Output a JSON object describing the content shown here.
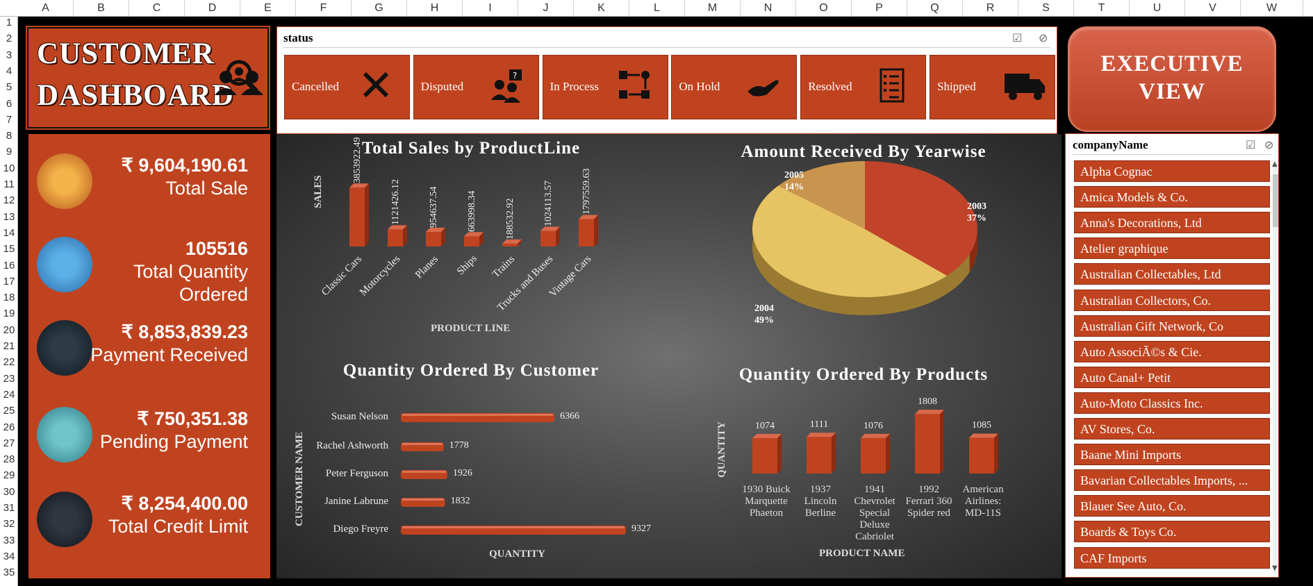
{
  "columns": [
    "A",
    "B",
    "C",
    "D",
    "E",
    "F",
    "G",
    "H",
    "I",
    "J",
    "K",
    "L",
    "M",
    "N",
    "O",
    "P",
    "Q",
    "R",
    "S",
    "T",
    "U",
    "V",
    "W"
  ],
  "rows": [
    "1",
    "2",
    "3",
    "4",
    "5",
    "6",
    "7",
    "8",
    "9",
    "10",
    "11",
    "12",
    "13",
    "14",
    "15",
    "16",
    "17",
    "18",
    "19",
    "20",
    "21",
    "22",
    "23",
    "24",
    "25",
    "26",
    "27",
    "28",
    "29",
    "30",
    "31",
    "32",
    "33",
    "34",
    "35"
  ],
  "title": {
    "line1": "CUSTOMER",
    "line2": "DASHBOARD"
  },
  "kpis": [
    {
      "value": "₹ 9,604,190.61",
      "label": "Total Sale",
      "icon": "money-bag-icon"
    },
    {
      "value": "105516",
      "label": "Total Quantity Ordered",
      "icon": "shopping-cart-icon"
    },
    {
      "value": "₹ 8,853,839.23",
      "label": "Payment Received",
      "icon": "check-badge-icon"
    },
    {
      "value": "₹ 750,351.38",
      "label": "Pending Payment",
      "icon": "alarm-clock-icon"
    },
    {
      "value": "₹ 8,254,400.00",
      "label": "Total Credit Limit",
      "icon": "credit-card-icon"
    }
  ],
  "status_slicer": {
    "header": "status",
    "items": [
      "Cancelled",
      "Disputed",
      "In Process",
      "On Hold",
      "Resolved",
      "Shipped"
    ]
  },
  "executive": {
    "line1": "EXECUTIVE",
    "line2": "VIEW"
  },
  "company_slicer": {
    "header": "companyName",
    "items": [
      "Alpha Cognac",
      "Amica Models & Co.",
      "Anna's Decorations, Ltd",
      "Atelier graphique",
      "Australian Collectables, Ltd",
      "Australian Collectors, Co.",
      "Australian Gift Network, Co",
      "Auto AssociÃ©s & Cie.",
      "Auto Canal+ Petit",
      "Auto-Moto Classics Inc.",
      "AV Stores, Co.",
      "Baane Mini Imports",
      "Bavarian Collectables Imports, ...",
      "Blauer See Auto, Co.",
      "Boards & Toys Co.",
      "CAF Imports"
    ]
  },
  "colors": {
    "accent": "#c0431f",
    "pie_2003": "#c0432a",
    "pie_2004": "#e6c464",
    "pie_2005": "#c9954e"
  },
  "chart_data": [
    {
      "type": "bar",
      "title": "Total Sales by ProductLine",
      "xlabel": "PRODUCT LINE",
      "ylabel": "SALES",
      "categories": [
        "Classic Cars",
        "Motorcycles",
        "Planes",
        "Ships",
        "Trains",
        "Trucks and Buses",
        "Vintage Cars"
      ],
      "values": [
        3853922.49,
        1121426.12,
        954637.54,
        663998.34,
        188532.92,
        1024113.57,
        1797559.63
      ],
      "labels": [
        "3853922.49",
        "1121426.12",
        "954637.54",
        "663998.34",
        "188532.92",
        "1024113.57",
        "1797559.63"
      ]
    },
    {
      "type": "pie",
      "title": "Amount Received By Yearwise",
      "slices": [
        {
          "name": "2003",
          "percent": 37,
          "label": "37%"
        },
        {
          "name": "2004",
          "percent": 49,
          "label": "49%"
        },
        {
          "name": "2005",
          "percent": 14,
          "label": "14%"
        }
      ]
    },
    {
      "type": "bar",
      "orientation": "horizontal",
      "title": "Quantity Ordered By Customer",
      "xlabel": "QUANTITY",
      "ylabel": "CUSTOMER NAME",
      "categories": [
        "Susan Nelson",
        "Rachel Ashworth",
        "Peter Ferguson",
        "Janine Labrune",
        "Diego Freyre"
      ],
      "values": [
        6366,
        1778,
        1926,
        1832,
        9327
      ],
      "labels": [
        "6366",
        "1778",
        "1926",
        "1832",
        "9327"
      ]
    },
    {
      "type": "bar",
      "title": "Quantity Ordered By Products",
      "xlabel": "PRODUCT NAME",
      "ylabel": "QUANTITY",
      "categories": [
        "1930 Buick Marquette Phaeton",
        "1937 Lincoln Berline",
        "1941 Chevrolet Special Deluxe Cabriolet",
        "1992 Ferrari 360 Spider red",
        "American Airlines: MD-11S"
      ],
      "category_lines": [
        [
          "1930 Buick",
          "Marquette",
          "Phaeton"
        ],
        [
          "1937",
          "Lincoln",
          "Berline"
        ],
        [
          "1941",
          "Chevrolet",
          "Special",
          "Deluxe",
          "Cabriolet"
        ],
        [
          "1992",
          "Ferrari 360",
          "Spider red"
        ],
        [
          "American",
          "Airlines:",
          "MD-11S"
        ]
      ],
      "values": [
        1074,
        1111,
        1076,
        1808,
        1085
      ],
      "labels": [
        "1074",
        "1111",
        "1076",
        "1808",
        "1085"
      ]
    }
  ]
}
